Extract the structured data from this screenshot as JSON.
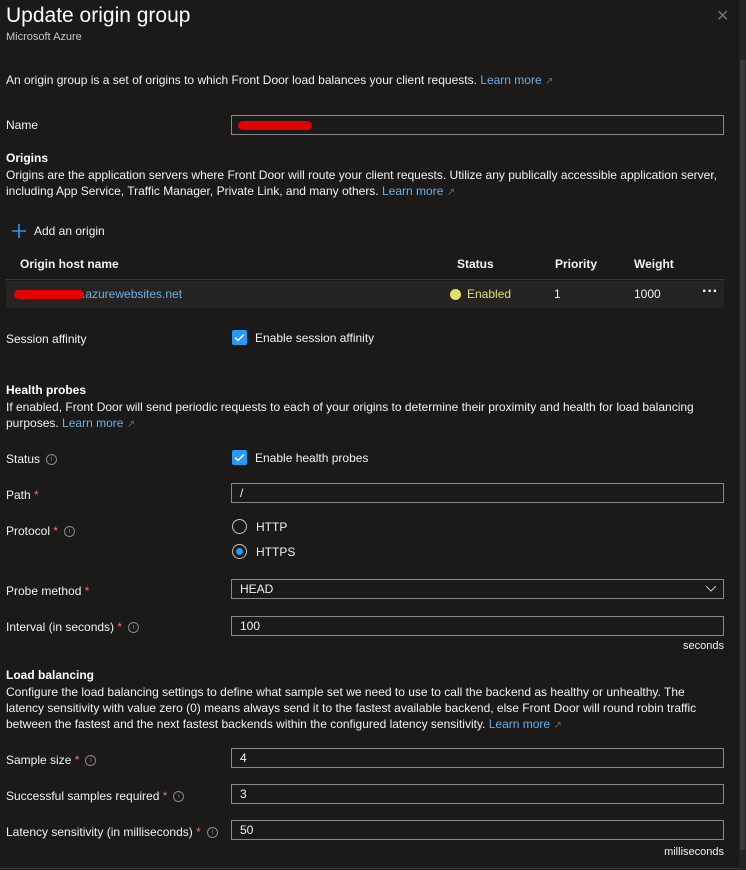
{
  "header": {
    "title": "Update origin group",
    "subtitle": "Microsoft Azure",
    "close_glyph": "✕"
  },
  "intro": {
    "text": "An origin group is a set of origins to which Front Door load balances your client requests.",
    "learn_more": "Learn more"
  },
  "name": {
    "label": "Name",
    "value": ""
  },
  "origins": {
    "heading": "Origins",
    "description": "Origins are the application servers where Front Door will route your client requests. Utilize any publically accessible application server, including App Service, Traffic Manager, Private Link, and many others.",
    "learn_more": "Learn more",
    "add_label": "Add an origin",
    "columns": [
      "Origin host name",
      "Status",
      "Priority",
      "Weight"
    ],
    "rows": [
      {
        "host_suffix": ".azurewebsites.net",
        "status": "Enabled",
        "priority": "1",
        "weight": "1000",
        "more": "···"
      }
    ]
  },
  "session_affinity": {
    "label": "Session affinity",
    "checkbox_label": "Enable session affinity",
    "checked": true
  },
  "health_probes": {
    "heading": "Health probes",
    "description": "If enabled, Front Door will send periodic requests to each of your origins to determine their proximity and health for load balancing purposes.",
    "learn_more": "Learn more",
    "status_label": "Status",
    "status_checkbox_label": "Enable health probes",
    "path_label": "Path",
    "path_value": "/",
    "protocol_label": "Protocol",
    "protocol_options": [
      "HTTP",
      "HTTPS"
    ],
    "protocol_selected": "HTTPS",
    "probe_method_label": "Probe method",
    "probe_method_value": "HEAD",
    "interval_label": "Interval (in seconds)",
    "interval_value": "100",
    "interval_unit": "seconds"
  },
  "load_balancing": {
    "heading": "Load balancing",
    "description": "Configure the load balancing settings to define what sample set we need to use to call the backend as healthy or unhealthy. The latency sensitivity with value zero (0) means always send it to the fastest available backend, else Front Door will round robin traffic between the fastest and the next fastest backends within the configured latency sensitivity.",
    "learn_more": "Learn more",
    "sample_size_label": "Sample size",
    "sample_size_value": "4",
    "successful_label": "Successful samples required",
    "successful_value": "3",
    "latency_label": "Latency sensitivity (in milliseconds)",
    "latency_value": "50",
    "latency_unit": "milliseconds"
  },
  "colors": {
    "background": "#1b1a19",
    "accent": "#2899f5",
    "link": "#69afe5",
    "status_enabled": "#dde36a",
    "required": "#f1707b"
  }
}
